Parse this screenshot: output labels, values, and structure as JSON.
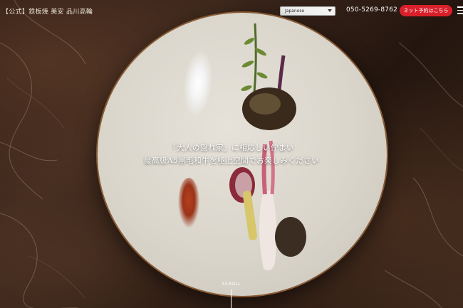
{
  "header": {
    "logo_text": "【公式】鉄板焼 美安 品川高輪",
    "language": {
      "selected": "Japanese"
    },
    "phone": "050-5269-8762",
    "reserve_label": "ネット予約はこちら",
    "menu_icon": "hamburger-menu-icon"
  },
  "hero": {
    "line1": "「大人の隠れ家」に相応しい佇まい",
    "line2": "最高級A5黒毛和牛を極上空間でお楽しみください",
    "scroll_label": "SCROLL"
  },
  "colors": {
    "accent": "#d9202a",
    "plate_rim": "#8a5a32"
  }
}
